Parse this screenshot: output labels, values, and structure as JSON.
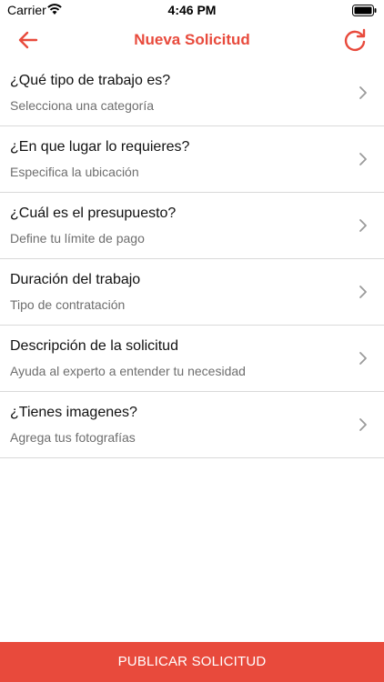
{
  "status_bar": {
    "carrier": "Carrier",
    "time": "4:46 PM"
  },
  "nav": {
    "title": "Nueva Solicitud",
    "back_icon": "arrow-left-icon",
    "refresh_icon": "refresh-icon"
  },
  "rows": [
    {
      "title": "¿Qué tipo de trabajo es?",
      "subtitle": "Selecciona una categoría"
    },
    {
      "title": "¿En que lugar lo requieres?",
      "subtitle": "Especifica la ubicación"
    },
    {
      "title": "¿Cuál es el presupuesto?",
      "subtitle": "Define tu límite de pago"
    },
    {
      "title": "Duración del trabajo",
      "subtitle": "Tipo de contratación"
    },
    {
      "title": "Descripción de la solicitud",
      "subtitle": "Ayuda al experto a entender tu necesidad"
    },
    {
      "title": "¿Tienes imagenes?",
      "subtitle": "Agrega tus fotografías"
    }
  ],
  "footer": {
    "button_label": "PUBLICAR SOLICITUD"
  },
  "colors": {
    "accent": "#e84a3c",
    "divider": "#d9d9d9",
    "subtitle": "#6e6e6e"
  }
}
